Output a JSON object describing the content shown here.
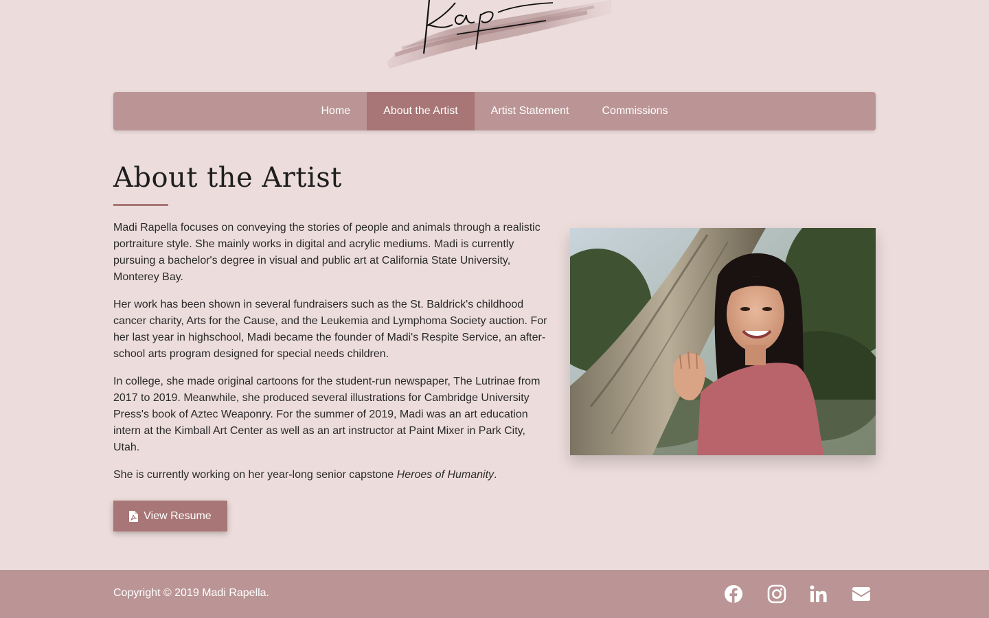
{
  "logo": {
    "signature_text": "Rapella",
    "icon": "signature-logo"
  },
  "nav": {
    "items": [
      {
        "label": "Home"
      },
      {
        "label": "About the Artist"
      },
      {
        "label": "Artist Statement"
      },
      {
        "label": "Commissions"
      }
    ],
    "active": "About the Artist"
  },
  "main": {
    "title": "About the Artist",
    "paragraphs": [
      "Madi Rapella focuses on conveying the stories of people and animals through a realistic portraiture style. She mainly works in digital and acrylic mediums. Madi is currently pursuing a bachelor's degree in visual and public art at California State University, Monterey Bay.",
      "Her work has been shown in several fundraisers such as the St. Baldrick's childhood cancer charity, Arts for the Cause, and the Leukemia and Lymphoma Society auction. For her last year in highschool, Madi became the founder of Madi's Respite Service, an after-school arts program designed for special needs children.",
      "In college, she made original cartoons for the student-run newspaper, The Lutrinae from 2017 to 2019. Meanwhile, she produced several illustrations for Cambridge University Press's book of Aztec Weaponry. For the summer of 2019, Madi was an art education intern at the Kimball Art Center as well as an art instructor at Paint Mixer in Park City, Utah."
    ],
    "capstone_prefix": "She is currently working on her year-long senior capstone ",
    "capstone_title": "Heroes of Humanity",
    "capstone_suffix": ".",
    "resume_button": {
      "label": "View Resume",
      "icon": "file-pdf-icon"
    },
    "photo": {
      "icon": "artist-portrait-photo"
    }
  },
  "footer": {
    "copyright": "Copyright © 2019 Madi Rapella.",
    "social": [
      {
        "icon": "facebook-icon"
      },
      {
        "icon": "instagram-icon"
      },
      {
        "icon": "linkedin-icon"
      },
      {
        "icon": "email-icon"
      }
    ]
  },
  "colors": {
    "background": "#ecdcdc",
    "nav_bg": "#bb9595",
    "accent": "#a87676",
    "text": "#2a2a2a",
    "footer_bg": "#bb9595"
  }
}
